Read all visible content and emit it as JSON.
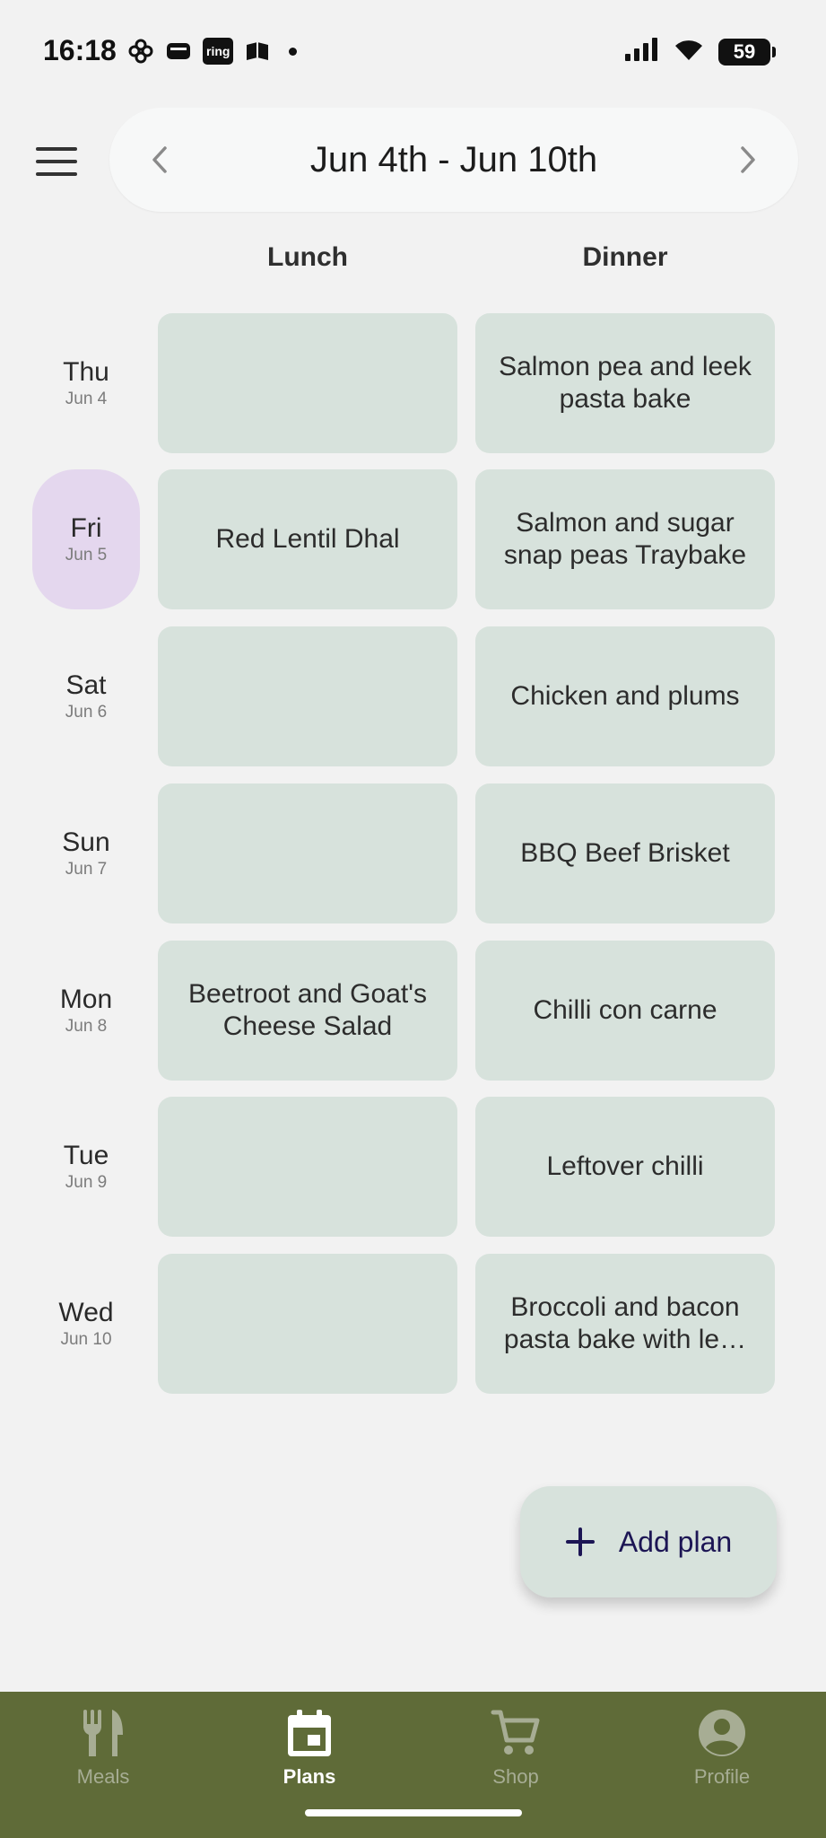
{
  "status_bar": {
    "time": "16:18",
    "ring_label": "ring",
    "battery": "59"
  },
  "header": {
    "week_title": "Jun 4th - Jun 10th"
  },
  "columns": {
    "lunch": "Lunch",
    "dinner": "Dinner"
  },
  "days": [
    {
      "name": "Thu",
      "date": "Jun 4",
      "lunch": "",
      "dinner": "Salmon pea and leek pasta bake"
    },
    {
      "name": "Fri",
      "date": "Jun 5",
      "lunch": "Red Lentil Dhal",
      "dinner": "Salmon and sugar snap peas Traybake",
      "today": true
    },
    {
      "name": "Sat",
      "date": "Jun 6",
      "lunch": "",
      "dinner": "Chicken and plums"
    },
    {
      "name": "Sun",
      "date": "Jun 7",
      "lunch": "",
      "dinner": "BBQ Beef Brisket"
    },
    {
      "name": "Mon",
      "date": "Jun 8",
      "lunch": "Beetroot and Goat's Cheese Salad",
      "dinner": "Chilli con carne"
    },
    {
      "name": "Tue",
      "date": "Jun 9",
      "lunch": "",
      "dinner": "Leftover chilli"
    },
    {
      "name": "Wed",
      "date": "Jun 10",
      "lunch": "",
      "dinner": "Broccoli and bacon pasta bake with le…"
    }
  ],
  "fab": {
    "label": "Add plan"
  },
  "nav": [
    {
      "label": "Meals",
      "icon": "fork-knife-icon"
    },
    {
      "label": "Plans",
      "icon": "calendar-icon",
      "active": true
    },
    {
      "label": "Shop",
      "icon": "cart-icon"
    },
    {
      "label": "Profile",
      "icon": "account-circle-icon"
    }
  ],
  "colors": {
    "accent_nav": "#5f6b38",
    "cell": "#d7e2dc",
    "today_highlight": "#e4d7ee",
    "fab_text": "#1c1554"
  }
}
